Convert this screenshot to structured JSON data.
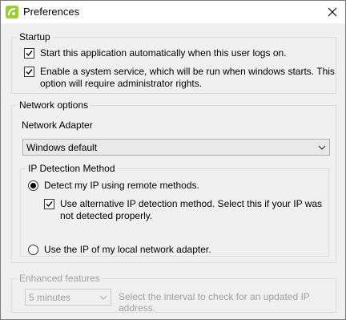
{
  "window": {
    "title": "Preferences"
  },
  "startup": {
    "legend": "Startup",
    "auto_start": {
      "label": "Start this application automatically when this user logs on.",
      "checked": true
    },
    "service": {
      "label_line1": "Enable a system service, which will be run when windows starts. This",
      "label_line2": "option will require administrator rights.",
      "checked": true
    }
  },
  "network": {
    "legend": "Network options",
    "adapter_label": "Network Adapter",
    "adapter_value": "Windows default",
    "ip_detection": {
      "legend": "IP Detection Method",
      "remote": {
        "label": "Detect my IP using remote methods.",
        "selected": true
      },
      "alternative": {
        "label_line1": "Use alternative IP detection method. Select this if your IP was",
        "label_line2": "not detected properly.",
        "checked": true
      },
      "local": {
        "label": "Use the IP of my local network adapter.",
        "selected": false
      }
    }
  },
  "enhanced": {
    "legend": "Enhanced features",
    "interval_value": "5 minutes",
    "interval_hint": "Select the interval to check for an updated IP address."
  }
}
